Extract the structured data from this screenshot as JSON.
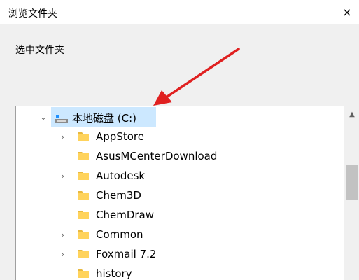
{
  "dialog": {
    "title": "浏览文件夹",
    "close_glyph": "×",
    "prompt": "选中文件夹"
  },
  "tree": {
    "root": {
      "label": "本地磁盘 (C:)",
      "expanded": true,
      "selected": true,
      "icon": "drive-icon"
    },
    "items": [
      {
        "label": "AppStore",
        "has_children": true
      },
      {
        "label": "AsusMCenterDownload",
        "has_children": false
      },
      {
        "label": "Autodesk",
        "has_children": true
      },
      {
        "label": "Chem3D",
        "has_children": false
      },
      {
        "label": "ChemDraw",
        "has_children": false
      },
      {
        "label": "Common",
        "has_children": true
      },
      {
        "label": "Foxmail 7.2",
        "has_children": true
      },
      {
        "label": "history",
        "has_children": false
      }
    ],
    "expander_collapsed_glyph": "›",
    "expander_expanded_glyph": "⌄"
  },
  "scrollbar": {
    "up_glyph": "▲"
  },
  "colors": {
    "selection": "#cce8ff",
    "folder": "#ffd35c",
    "annotation_arrow": "#e02020"
  }
}
